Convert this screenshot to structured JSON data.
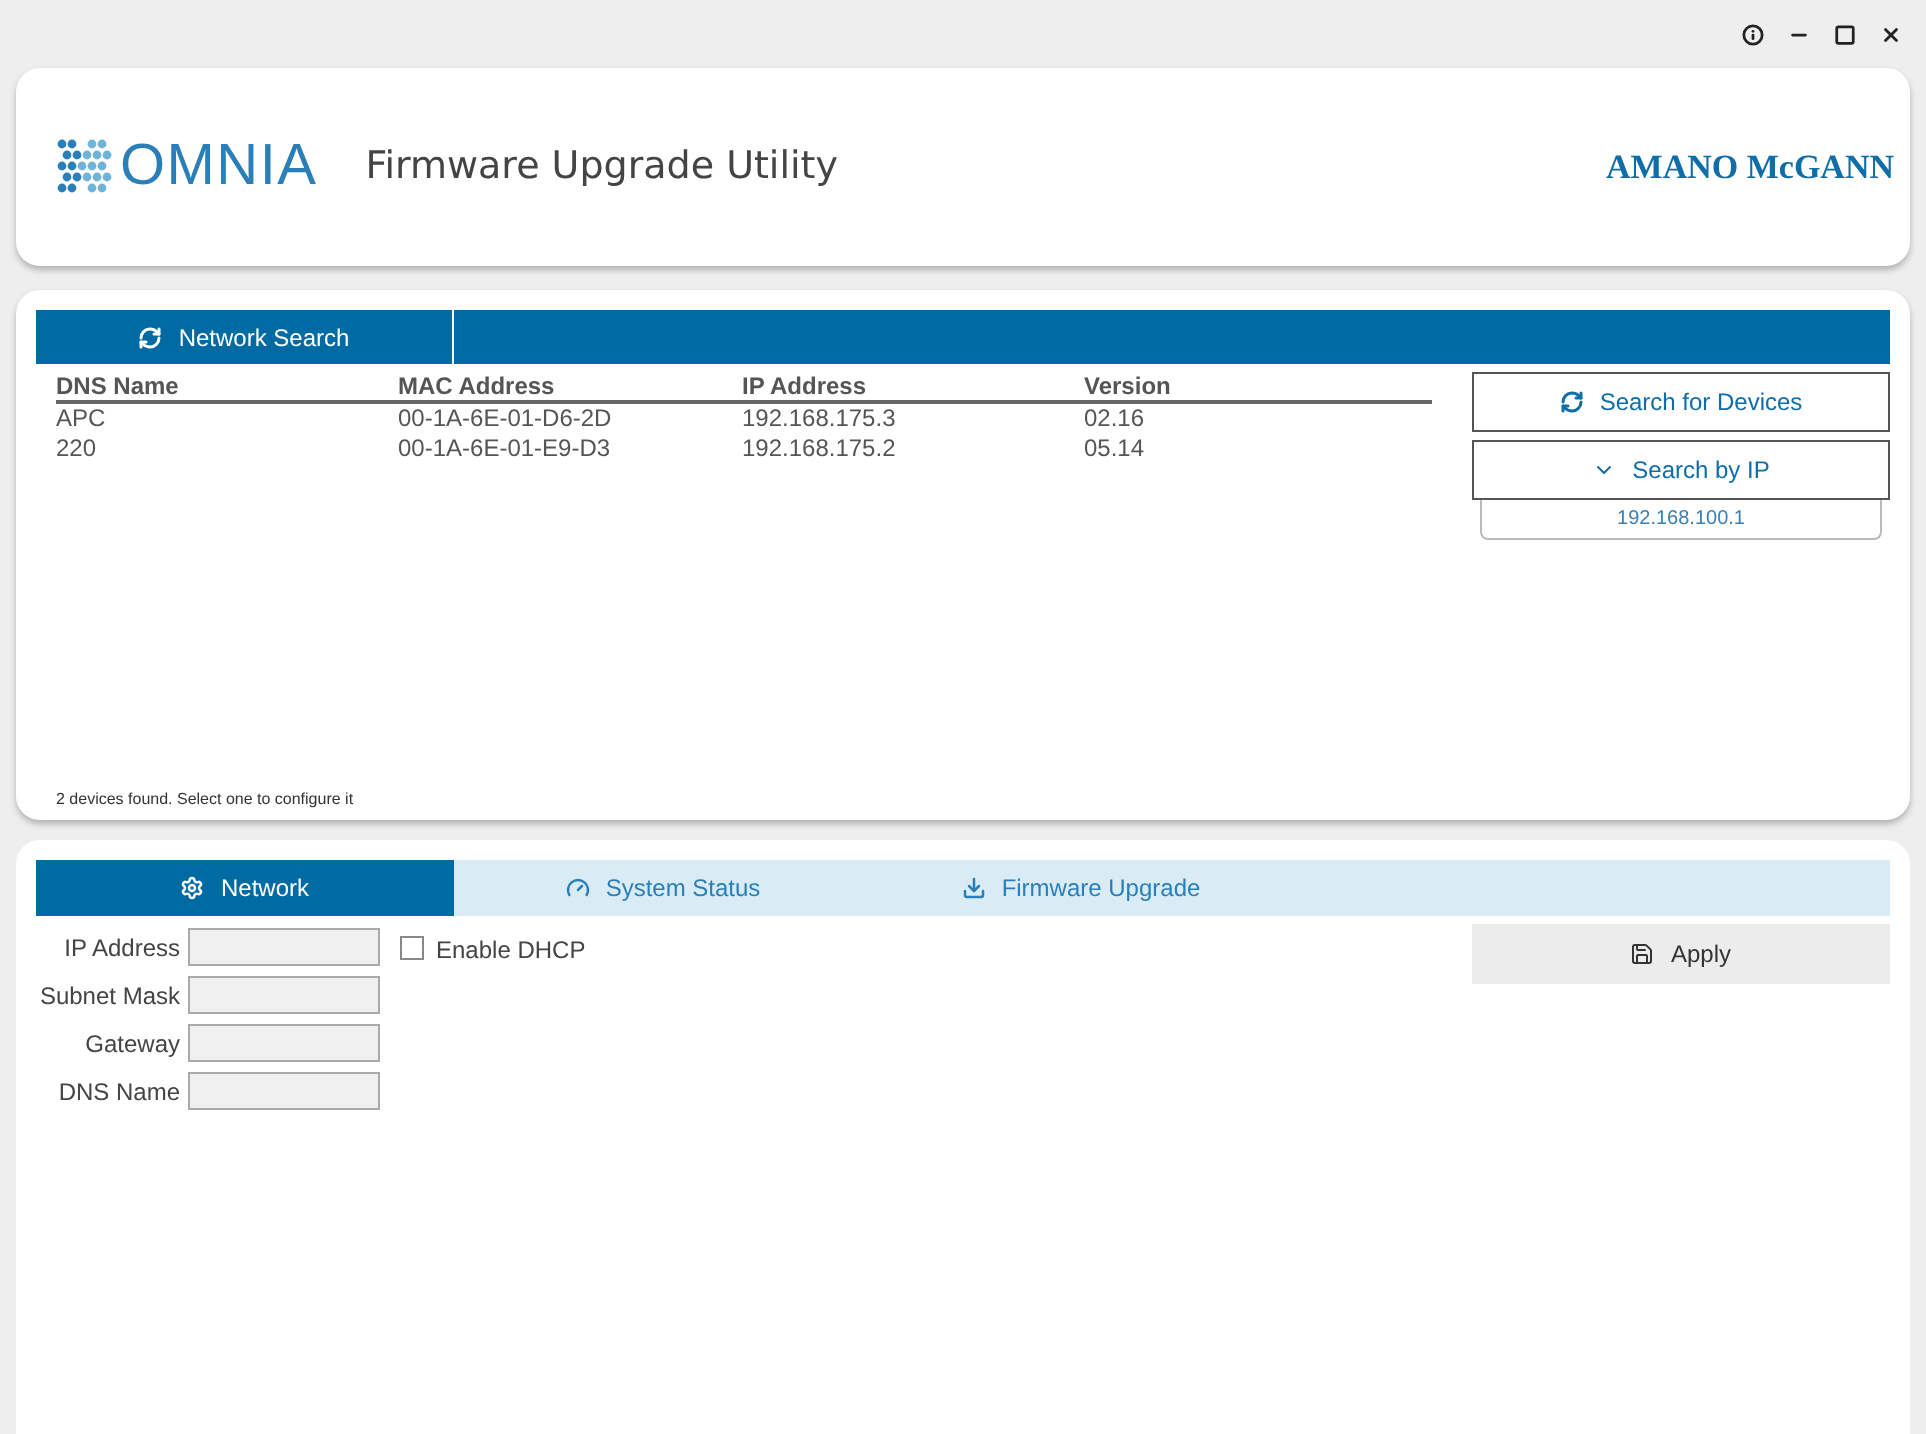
{
  "window": {
    "controls": [
      {
        "kind": "info"
      },
      {
        "kind": "minimize"
      },
      {
        "kind": "maximize"
      },
      {
        "kind": "close"
      }
    ]
  },
  "header": {
    "logo_text": "OMNIA",
    "title": "Firmware Upgrade Utility",
    "brand": "AMANO McGANN"
  },
  "search_panel": {
    "tab": {
      "label": "Network Search",
      "selected": true
    },
    "table": {
      "columns": [
        "DNS Name",
        "MAC Address",
        "IP Address",
        "Version"
      ],
      "rows": [
        {
          "cells": [
            "APC",
            "00-1A-6E-01-D6-2D",
            "192.168.175.3",
            "02.16"
          ],
          "selected": false
        },
        {
          "cells": [
            "220",
            "00-1A-6E-01-E9-D3",
            "192.168.175.2",
            "05.14"
          ],
          "selected": false
        }
      ]
    },
    "search_button": "Search for Devices",
    "search_by_ip": {
      "label": "Search by IP",
      "expanded": true,
      "value": "192.168.100.1"
    },
    "status": "2 devices found. Select one to configure it"
  },
  "config_panel": {
    "tabs": [
      {
        "label": "Network",
        "selected": true
      },
      {
        "label": "System Status",
        "selected": false
      },
      {
        "label": "Firmware Upgrade",
        "selected": false
      }
    ],
    "fields": [
      {
        "label": "IP Address"
      },
      {
        "label": "Subnet Mask"
      },
      {
        "label": "Gateway"
      },
      {
        "label": "DNS Name"
      }
    ],
    "dhcp": {
      "label": "Enable DHCP",
      "checked": false
    },
    "apply_button": "Apply"
  }
}
